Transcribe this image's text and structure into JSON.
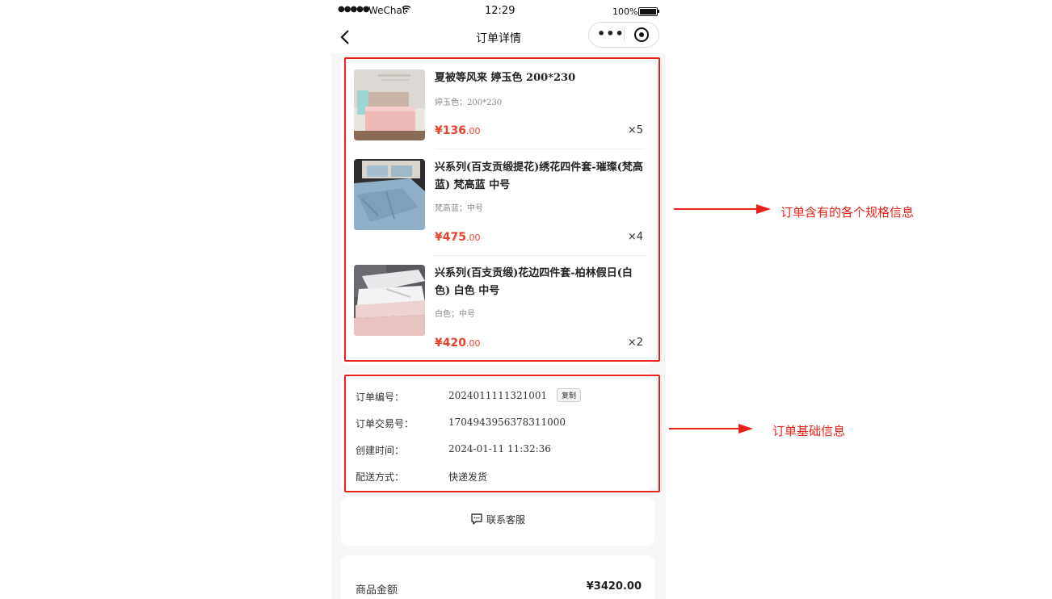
{
  "status_bar": {
    "carrier": "WeChat",
    "time": "12:29",
    "battery": "100%"
  },
  "nav": {
    "title": "订单详情"
  },
  "products": [
    {
      "name": "夏被等风来 婷玉色 200*230",
      "spec": "婷玉色；200*230",
      "price_int": "¥136",
      "price_dec": ".00",
      "qty": "×5"
    },
    {
      "name": "兴系列(百支贡缎提花)绣花四件套-璀璨(梵高蓝) 梵高蓝 中号",
      "spec": "梵高蓝；中号",
      "price_int": "¥475",
      "price_dec": ".00",
      "qty": "×4"
    },
    {
      "name": "兴系列(百支贡缎)花边四件套-柏林假日(白色) 白色 中号",
      "spec": "白色；中号",
      "price_int": "¥420",
      "price_dec": ".00",
      "qty": "×2"
    }
  ],
  "order_info": [
    {
      "label": "订单编号：",
      "value": "2024011111321001"
    },
    {
      "label": "订单交易号：",
      "value": "1704943956378311000"
    },
    {
      "label": "创建时间：",
      "value": "2024-01-11 11:32:36"
    },
    {
      "label": "配送方式：",
      "value": "快递发货"
    }
  ],
  "copy_label": "复制",
  "service_label": "联系客服",
  "amount": {
    "label": "商品金额",
    "value": "¥3420.00"
  },
  "annotations": {
    "products": "订单含有的各个规格信息",
    "info": "订单基础信息"
  },
  "colors": {
    "accent": "#e8432e",
    "annotation": "#e8221b"
  }
}
